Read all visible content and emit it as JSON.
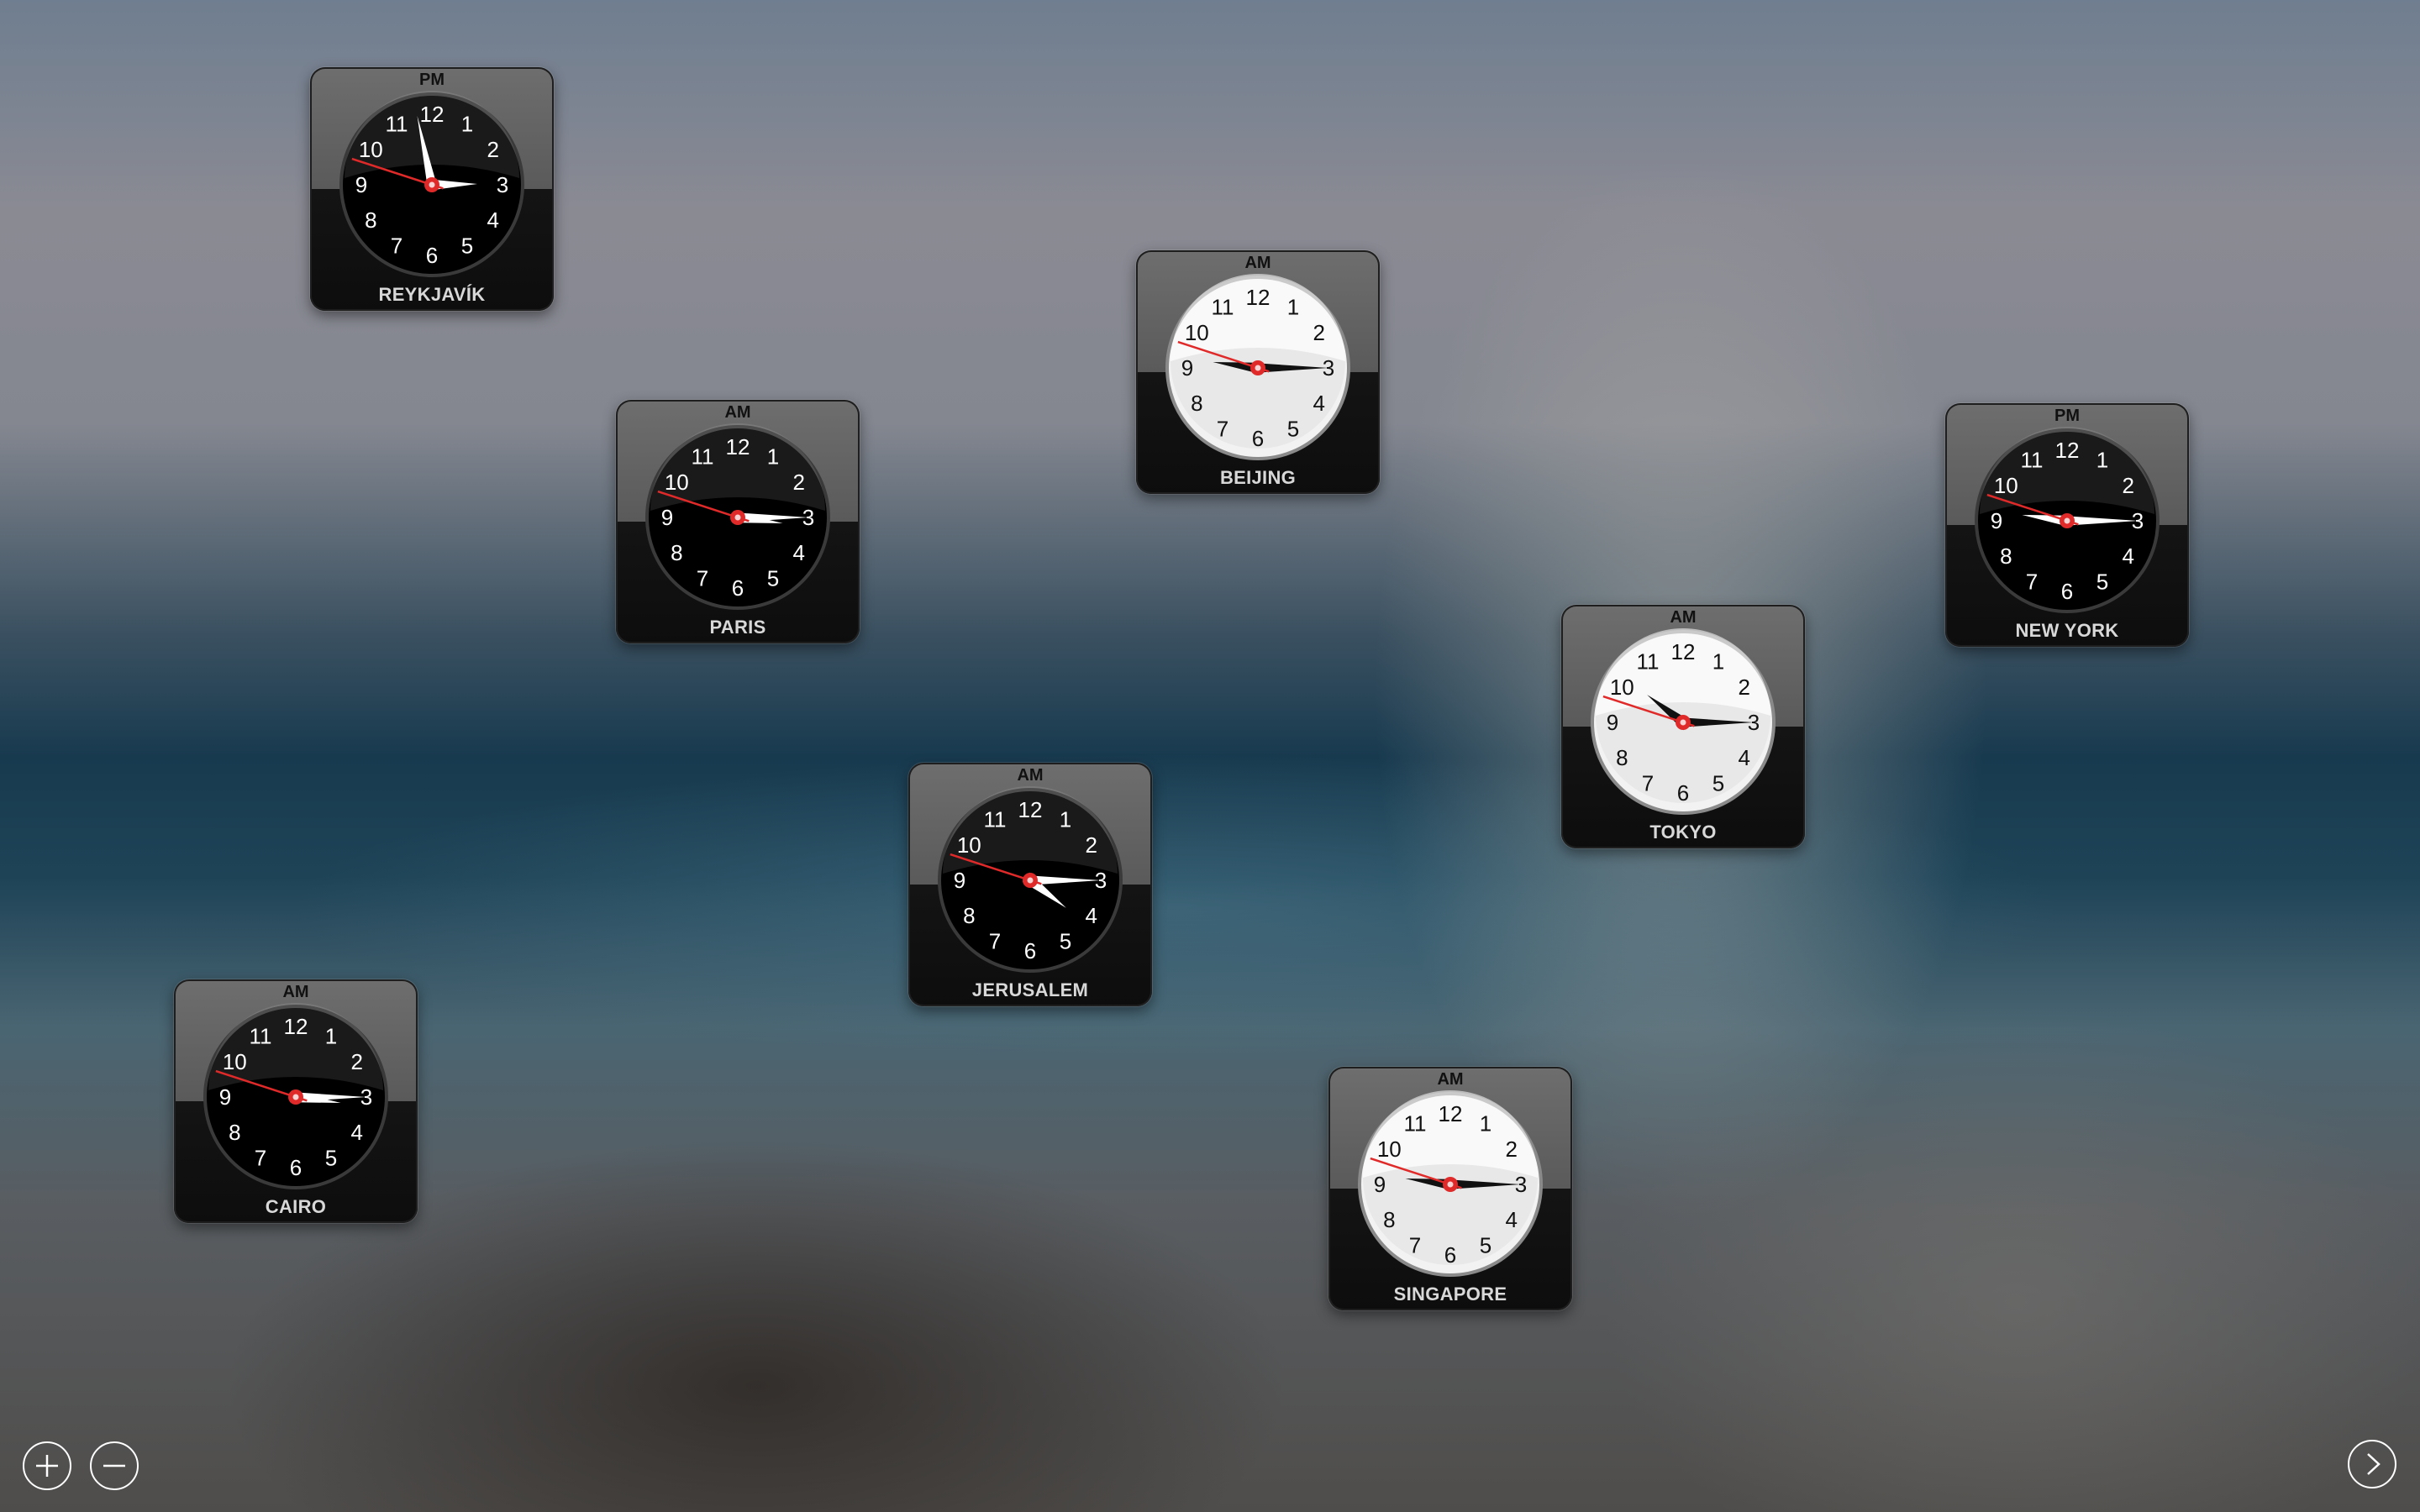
{
  "controls": {
    "add_icon": "plus-icon",
    "remove_icon": "minus-icon",
    "next_icon": "chevron-right-icon"
  },
  "clocks": [
    {
      "id": "reykjavik",
      "city": "REYKJAVÍK",
      "period": "PM",
      "theme": "dark",
      "hour": 2,
      "minute": 58,
      "second": 48
    },
    {
      "id": "paris",
      "city": "PARIS",
      "period": "AM",
      "theme": "dark",
      "hour": 3,
      "minute": 15,
      "second": 48
    },
    {
      "id": "beijing",
      "city": "BEIJING",
      "period": "AM",
      "theme": "light",
      "hour": 9,
      "minute": 15,
      "second": 48
    },
    {
      "id": "new-york",
      "city": "NEW YORK",
      "period": "PM",
      "theme": "dark",
      "hour": 9,
      "minute": 15,
      "second": 48
    },
    {
      "id": "tokyo",
      "city": "TOKYO",
      "period": "AM",
      "theme": "light",
      "hour": 10,
      "minute": 15,
      "second": 48
    },
    {
      "id": "jerusalem",
      "city": "JERUSALEM",
      "period": "AM",
      "theme": "dark",
      "hour": 4,
      "minute": 15,
      "second": 48
    },
    {
      "id": "cairo",
      "city": "CAIRO",
      "period": "AM",
      "theme": "dark",
      "hour": 3,
      "minute": 15,
      "second": 48
    },
    {
      "id": "singapore",
      "city": "SINGAPORE",
      "period": "AM",
      "theme": "light",
      "hour": 9,
      "minute": 15,
      "second": 48
    }
  ],
  "colors": {
    "second_hand": "#e02a2a",
    "dark_face": "#000000",
    "light_face": "#f2f2f2"
  }
}
